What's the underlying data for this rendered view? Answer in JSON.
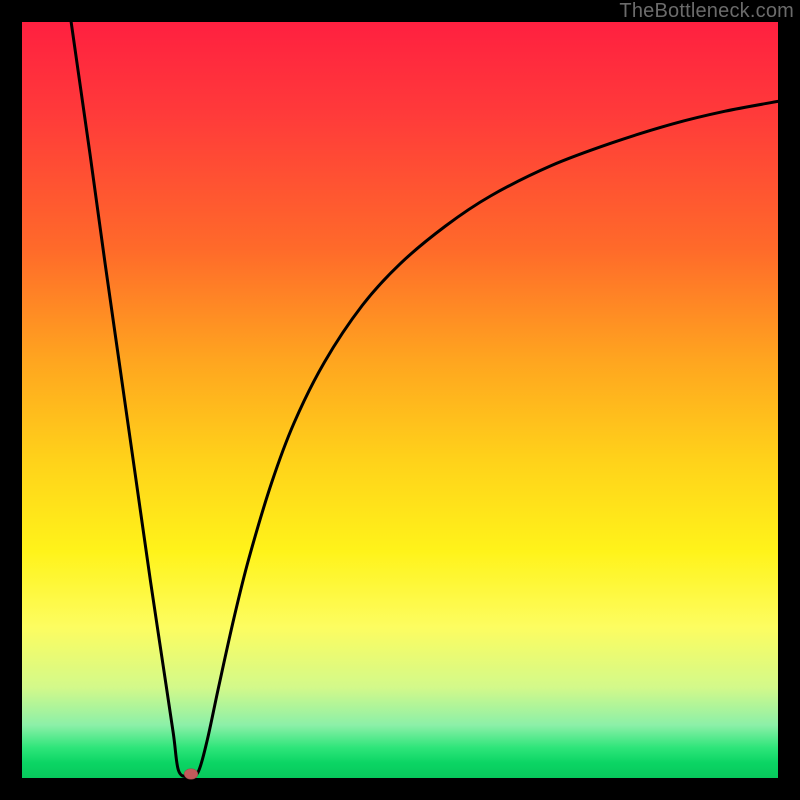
{
  "watermark": "TheBottleneck.com",
  "chart_data": {
    "type": "line",
    "title": "",
    "xlabel": "",
    "ylabel": "",
    "xlim": [
      0,
      100
    ],
    "ylim": [
      0,
      100
    ],
    "grid": false,
    "background": {
      "type": "vertical-gradient",
      "stops": [
        {
          "pos": 0.0,
          "color": "#ff2040"
        },
        {
          "pos": 0.12,
          "color": "#ff3a3a"
        },
        {
          "pos": 0.3,
          "color": "#ff6a2a"
        },
        {
          "pos": 0.45,
          "color": "#ffa61f"
        },
        {
          "pos": 0.58,
          "color": "#ffd21a"
        },
        {
          "pos": 0.7,
          "color": "#fff31a"
        },
        {
          "pos": 0.8,
          "color": "#fdfd60"
        },
        {
          "pos": 0.88,
          "color": "#d3f98a"
        },
        {
          "pos": 0.93,
          "color": "#8cf0a8"
        },
        {
          "pos": 0.96,
          "color": "#2ee57a"
        },
        {
          "pos": 0.98,
          "color": "#0bd564"
        },
        {
          "pos": 1.0,
          "color": "#07c85c"
        }
      ]
    },
    "series": [
      {
        "name": "bottleneck-curve",
        "color": "#000000",
        "points": [
          {
            "x": 6.5,
            "y": 100.0
          },
          {
            "x": 7.5,
            "y": 93.0
          },
          {
            "x": 9.0,
            "y": 82.5
          },
          {
            "x": 11.0,
            "y": 68.0
          },
          {
            "x": 13.0,
            "y": 54.0
          },
          {
            "x": 15.0,
            "y": 40.0
          },
          {
            "x": 17.0,
            "y": 26.0
          },
          {
            "x": 18.5,
            "y": 16.0
          },
          {
            "x": 20.0,
            "y": 6.0
          },
          {
            "x": 20.7,
            "y": 1.0
          },
          {
            "x": 22.0,
            "y": 0.2
          },
          {
            "x": 23.3,
            "y": 0.8
          },
          {
            "x": 24.5,
            "y": 5.0
          },
          {
            "x": 26.0,
            "y": 12.0
          },
          {
            "x": 28.0,
            "y": 21.0
          },
          {
            "x": 30.0,
            "y": 29.0
          },
          {
            "x": 33.0,
            "y": 39.0
          },
          {
            "x": 36.0,
            "y": 47.0
          },
          {
            "x": 40.0,
            "y": 55.0
          },
          {
            "x": 45.0,
            "y": 62.5
          },
          {
            "x": 50.0,
            "y": 68.0
          },
          {
            "x": 56.0,
            "y": 73.0
          },
          {
            "x": 62.0,
            "y": 77.0
          },
          {
            "x": 70.0,
            "y": 81.0
          },
          {
            "x": 78.0,
            "y": 84.0
          },
          {
            "x": 86.0,
            "y": 86.5
          },
          {
            "x": 93.0,
            "y": 88.2
          },
          {
            "x": 100.0,
            "y": 89.5
          }
        ]
      }
    ],
    "marker": {
      "x": 22.3,
      "y": 0.5,
      "color": "#c25a5a"
    }
  }
}
